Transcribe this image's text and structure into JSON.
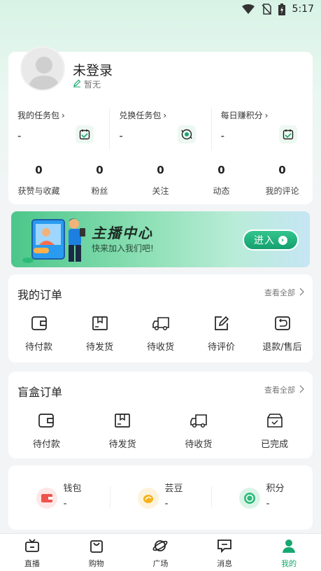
{
  "status_bar": {
    "time": "5:17"
  },
  "profile": {
    "name": "未登录",
    "subtitle": "暂无"
  },
  "tasks": [
    {
      "label": "我的任务包",
      "value": "-",
      "icon": "calendar-check-icon"
    },
    {
      "label": "兑换任务包",
      "value": "-",
      "icon": "exchange-icon"
    },
    {
      "label": "每日赚积分",
      "value": "-",
      "icon": "calendar-check-icon"
    }
  ],
  "stats": [
    {
      "value": "0",
      "label": "获赞与收藏"
    },
    {
      "value": "0",
      "label": "粉丝"
    },
    {
      "value": "0",
      "label": "关注"
    },
    {
      "value": "0",
      "label": "动态"
    },
    {
      "value": "0",
      "label": "我的评论"
    }
  ],
  "banner": {
    "title": "主播中心",
    "subtitle": "快来加入我们吧!",
    "button": "进入"
  },
  "orders": {
    "title": "我的订单",
    "more": "查看全部",
    "items": [
      {
        "label": "待付款",
        "icon": "wallet-icon"
      },
      {
        "label": "待发货",
        "icon": "box-icon"
      },
      {
        "label": "待收货",
        "icon": "truck-icon"
      },
      {
        "label": "待评价",
        "icon": "edit-icon"
      },
      {
        "label": "退款/售后",
        "icon": "refund-icon"
      }
    ]
  },
  "blind_box": {
    "title": "盲盒订单",
    "more": "查看全部",
    "items": [
      {
        "label": "待付款",
        "icon": "wallet-icon"
      },
      {
        "label": "待发货",
        "icon": "box-icon"
      },
      {
        "label": "待收货",
        "icon": "truck-icon"
      },
      {
        "label": "已完成",
        "icon": "completed-icon"
      }
    ]
  },
  "wallet": [
    {
      "label": "钱包",
      "value": "-",
      "icon": "wallet-icon",
      "color": "#f0524d"
    },
    {
      "label": "芸豆",
      "value": "-",
      "icon": "bean-icon",
      "color": "#f5b21b"
    },
    {
      "label": "积分",
      "value": "-",
      "icon": "points-icon",
      "color": "#2dbb7c"
    }
  ],
  "nav": [
    {
      "label": "直播",
      "icon": "tv-icon"
    },
    {
      "label": "购物",
      "icon": "shopping-bag-icon"
    },
    {
      "label": "广场",
      "icon": "planet-icon"
    },
    {
      "label": "消息",
      "icon": "message-icon"
    },
    {
      "label": "我的",
      "icon": "person-icon",
      "active": true
    }
  ],
  "colors": {
    "accent": "#16a870",
    "background": "#f3f4f6"
  }
}
